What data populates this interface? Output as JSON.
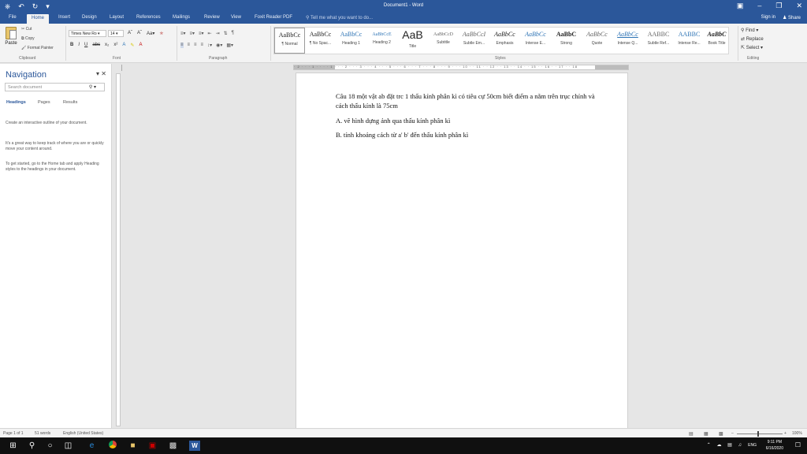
{
  "window": {
    "title": "Document1 - Word",
    "qat": [
      "⎈",
      "↶",
      "↻",
      "▾"
    ],
    "controls": [
      "▣",
      "–",
      "❐",
      "✕"
    ]
  },
  "tabs": [
    "File",
    "Home",
    "Insert",
    "Design",
    "Layout",
    "References",
    "Mailings",
    "Review",
    "View",
    "Foxit Reader PDF"
  ],
  "active_tab": "Home",
  "tell_me": "Tell me what you want to do...",
  "sign_in": "Sign in",
  "share": "Share",
  "ribbon": {
    "clipboard": {
      "paste": "Paste",
      "cut": "Cut",
      "copy": "Copy",
      "format_painter": "Format Painter",
      "label": "Clipboard"
    },
    "font": {
      "name": "Times New Ro",
      "size": "14",
      "label": "Font",
      "buttons": [
        "B",
        "I",
        "U",
        "abc",
        "x₂",
        "x²"
      ]
    },
    "paragraph": {
      "label": "Paragraph",
      "pilcrow": "¶"
    },
    "styles": {
      "label": "Styles",
      "items": [
        {
          "preview": "AaBbCc",
          "name": "¶ Normal"
        },
        {
          "preview": "AaBbCc",
          "name": "¶ No Spac..."
        },
        {
          "preview": "AaBbCc",
          "name": "Heading 1"
        },
        {
          "preview": "AaBbCcE",
          "name": "Heading 2"
        },
        {
          "preview": "AaB",
          "name": "Title"
        },
        {
          "preview": "AaBbCcD",
          "name": "Subtitle"
        },
        {
          "preview": "AaBbCcI",
          "name": "Subtle Em..."
        },
        {
          "preview": "AaBbCc",
          "name": "Emphasis"
        },
        {
          "preview": "AaBbCc",
          "name": "Intense E..."
        },
        {
          "preview": "AaBbC",
          "name": "Strong"
        },
        {
          "preview": "AaBbCc",
          "name": "Quote"
        },
        {
          "preview": "AaBbCc",
          "name": "Intense Q..."
        },
        {
          "preview": "AABBC",
          "name": "Subtle Ref..."
        },
        {
          "preview": "AABBC",
          "name": "Intense Re..."
        },
        {
          "preview": "AaBbC",
          "name": "Book Title"
        }
      ]
    },
    "editing": {
      "find": "Find",
      "replace": "Replace",
      "select": "Select",
      "label": "Editing"
    }
  },
  "navigation": {
    "title": "Navigation",
    "search_placeholder": "Search document",
    "tabs": [
      "Headings",
      "Pages",
      "Results"
    ],
    "help": [
      "Create an interactive outline of your document.",
      "It's a great way to keep track of where you are or quickly move your content around.",
      "To get started, go to the Home tab and apply Heading styles to the headings in your document."
    ]
  },
  "ruler": {
    "ticks": "· 2 · · · 1 · · · · 1 · · · 2 · · · 3 · · · 4 · · · 5 · · · 6 · · · 7 · · · 8 · · · 9 · · · 10 · · 11 · · 12 · · 13 · · 14 · · 15 · · 16 · · 17 · · 18"
  },
  "document": {
    "paragraphs": [
      "Câu 18 một vật ab đặt trc 1 thấu kính phân kì có tiêu cự 50cm biết điểm a nằm trên trục chính và cách thấu kính là 75cm",
      "A. vẽ hình dựng ảnh qua thấu kính phân kì",
      "B. tính khoảng cách từ a' b' đến thấu kính phân kì"
    ]
  },
  "status": {
    "page": "Page 1 of 1",
    "words": "51 words",
    "language": "English (United States)",
    "zoom": "100%"
  },
  "taskbar": {
    "lang": "ENG",
    "time": "9:11 PM",
    "date": "6/16/2020"
  }
}
